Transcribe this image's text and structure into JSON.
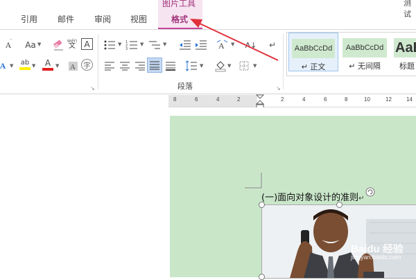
{
  "tabs": {
    "references": "引用",
    "mailings": "邮件",
    "review": "审阅",
    "view": "视图",
    "context_group": "图片工具",
    "format": "格式",
    "corner": "测试"
  },
  "ribbon": {
    "font_size_icon": "A",
    "change_case": "Aa",
    "phonetic_top": "wén",
    "phonetic_bottom": "文",
    "char_border": "A",
    "text_effect": "A",
    "highlight": "ab",
    "font_color": "A",
    "enclose_char": "字",
    "sort": "A↓",
    "styles": [
      {
        "preview": "AaBbCcDd",
        "name": "↵ 正文"
      },
      {
        "preview": "AaBbCcDd",
        "name": "↵ 无间隔"
      },
      {
        "preview": "AaB",
        "name": "标题"
      }
    ],
    "paragraph_label": "段落"
  },
  "ruler": {
    "numbers": [
      "8",
      "6",
      "4",
      "2",
      "2",
      "4",
      "6",
      "8",
      "10",
      "12",
      "14"
    ]
  },
  "document": {
    "heading": "(一)面向对象设计的准则",
    "paragraph_mark": "↵",
    "watermark": "Baidu 经验",
    "watermark_url": "jingyan.baidu.com"
  },
  "colors": {
    "context_tab": "#a1347b",
    "page_bg": "#c9e6c9",
    "arrow": "#e0303b",
    "highlight_yellow": "#ffee00",
    "font_red": "#e02020"
  }
}
